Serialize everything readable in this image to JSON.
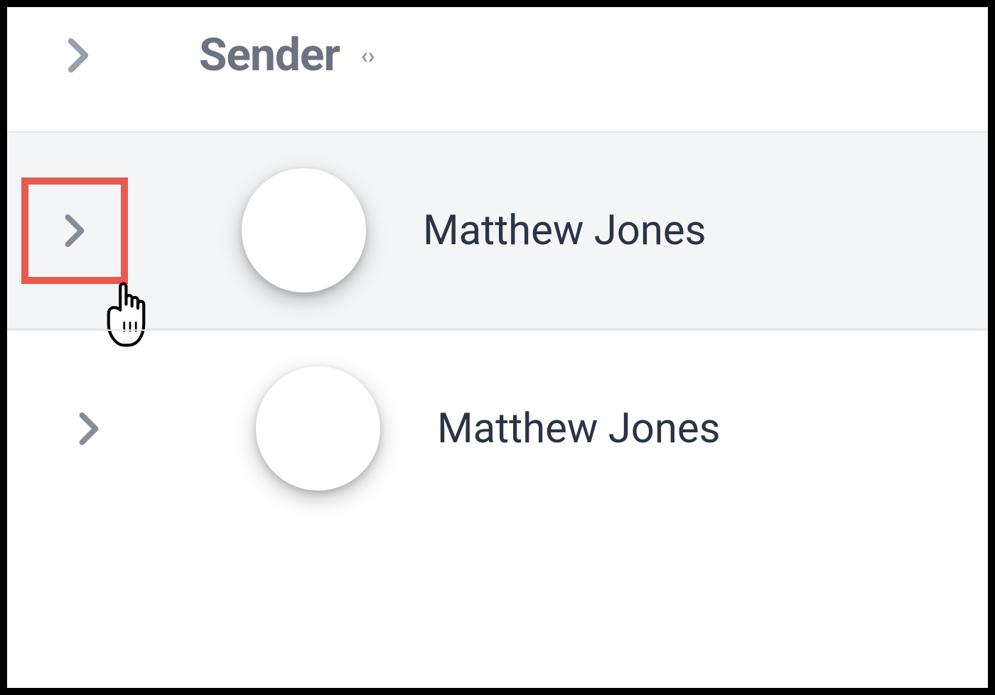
{
  "header": {
    "column_label": "Sender",
    "sort_glyph": "‹›"
  },
  "rows": [
    {
      "sender": "Matthew Jones",
      "selected": true,
      "highlighted": true
    },
    {
      "sender": "Matthew Jones",
      "selected": false,
      "highlighted": false
    }
  ],
  "colors": {
    "highlight_border": "#e85a4f",
    "selected_bg": "#f4f5f7",
    "text_muted": "#6b7280",
    "text_body": "#2a3446"
  }
}
